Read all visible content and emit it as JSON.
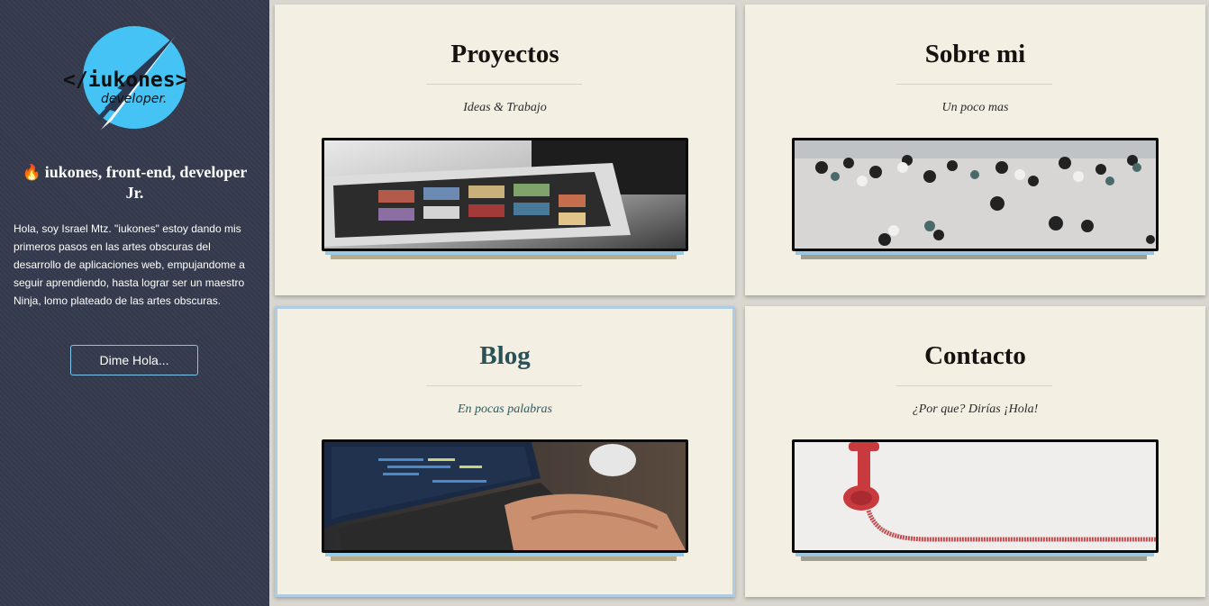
{
  "sidebar": {
    "logo": {
      "text": "</iukones>",
      "subtext": "developer.",
      "icon": "rocket-logo-icon",
      "circle_color": "#45c3f5"
    },
    "title_icon": "fire-icon",
    "title": "iukones, front-end, developer Jr.",
    "bio": "Hola, soy Israel Mtz. \"iukones\" estoy dando mis primeros pasos en las artes obscuras del desarrollo de aplicaciones web, empujandome a seguir aprendiendo, hasta lograr ser un maestro Ninja, lomo plateado de las artes obscuras.",
    "button_label": "Dime Hola..."
  },
  "cards": [
    {
      "title": "Proyectos",
      "subtitle": "Ideas & Trabajo",
      "image": "tablet-on-laptop-photo"
    },
    {
      "title": "Sobre mi",
      "subtitle": "Un poco mas",
      "image": "people-in-office-photo"
    },
    {
      "title": "Blog",
      "subtitle": "En pocas palabras",
      "image": "hands-typing-laptop-photo"
    },
    {
      "title": "Contacto",
      "subtitle": "¿Por que? Dirías ¡Hola!",
      "image": "red-telephone-handset-photo"
    }
  ],
  "colors": {
    "sidebar_bg": "#353b4e",
    "card_bg": "#f3efe3",
    "accent": "#7ec7ee",
    "blog_title": "#2a5058"
  }
}
